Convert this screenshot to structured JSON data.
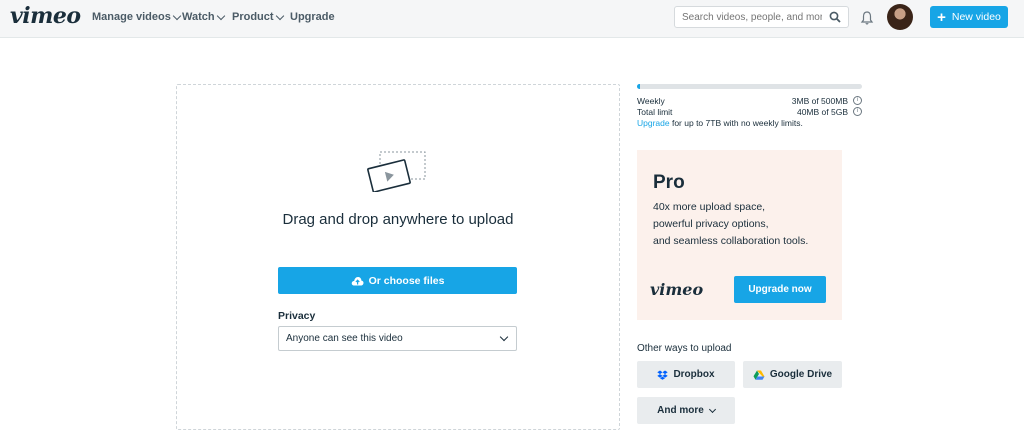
{
  "header": {
    "logo": "vimeo",
    "nav": [
      {
        "label": "Manage videos",
        "has_menu": true
      },
      {
        "label": "Watch",
        "has_menu": true
      },
      {
        "label": "Product",
        "has_menu": true
      },
      {
        "label": "Upgrade",
        "has_menu": false
      }
    ],
    "search_placeholder": "Search videos, people, and more",
    "new_video_label": "New video",
    "icons": {
      "search": "search-icon",
      "notifications": "bell-icon",
      "avatar": "user-avatar",
      "plus": "plus-icon"
    }
  },
  "upload": {
    "title": "Drag and drop anywhere to upload",
    "choose_label": "Or choose files",
    "privacy_label": "Privacy",
    "privacy_value": "Anyone can see this video"
  },
  "quota": {
    "weekly_label": "Weekly",
    "weekly_value": "3MB of 500MB",
    "total_label": "Total limit",
    "total_value": "40MB of 5GB",
    "upgrade_link": "Upgrade",
    "upgrade_text": " for up to 7TB with no weekly limits.",
    "weekly_used_fraction": 0.006
  },
  "pro": {
    "title": "Pro",
    "lines": [
      "40x more upload space,",
      "powerful privacy options,",
      "and seamless collaboration tools."
    ],
    "logo": "vimeo",
    "button_label": "Upgrade now",
    "background": "#fcf1ec"
  },
  "other_ways": {
    "label": "Other ways to upload",
    "dropbox": "Dropbox",
    "google_drive": "Google Drive",
    "more": "And more"
  },
  "colors": {
    "accent": "#17a5e6",
    "text": "#1a2e3b"
  }
}
